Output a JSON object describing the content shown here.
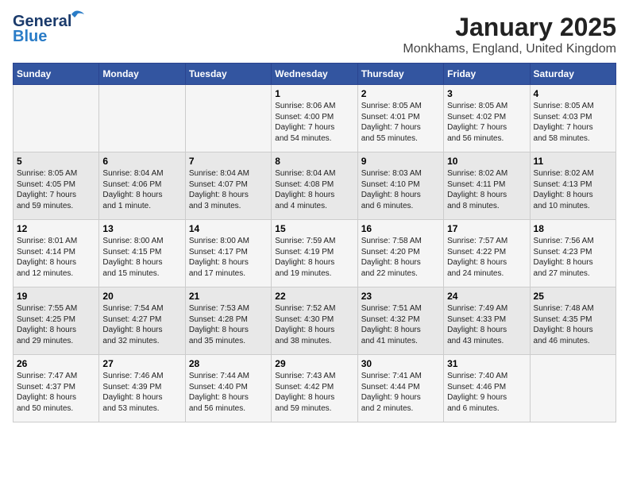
{
  "header": {
    "logo_general": "General",
    "logo_blue": "Blue",
    "month_title": "January 2025",
    "location": "Monkhams, England, United Kingdom"
  },
  "weekdays": [
    "Sunday",
    "Monday",
    "Tuesday",
    "Wednesday",
    "Thursday",
    "Friday",
    "Saturday"
  ],
  "weeks": [
    [
      {
        "day": "",
        "info": ""
      },
      {
        "day": "",
        "info": ""
      },
      {
        "day": "",
        "info": ""
      },
      {
        "day": "1",
        "info": "Sunrise: 8:06 AM\nSunset: 4:00 PM\nDaylight: 7 hours\nand 54 minutes."
      },
      {
        "day": "2",
        "info": "Sunrise: 8:05 AM\nSunset: 4:01 PM\nDaylight: 7 hours\nand 55 minutes."
      },
      {
        "day": "3",
        "info": "Sunrise: 8:05 AM\nSunset: 4:02 PM\nDaylight: 7 hours\nand 56 minutes."
      },
      {
        "day": "4",
        "info": "Sunrise: 8:05 AM\nSunset: 4:03 PM\nDaylight: 7 hours\nand 58 minutes."
      }
    ],
    [
      {
        "day": "5",
        "info": "Sunrise: 8:05 AM\nSunset: 4:05 PM\nDaylight: 7 hours\nand 59 minutes."
      },
      {
        "day": "6",
        "info": "Sunrise: 8:04 AM\nSunset: 4:06 PM\nDaylight: 8 hours\nand 1 minute."
      },
      {
        "day": "7",
        "info": "Sunrise: 8:04 AM\nSunset: 4:07 PM\nDaylight: 8 hours\nand 3 minutes."
      },
      {
        "day": "8",
        "info": "Sunrise: 8:04 AM\nSunset: 4:08 PM\nDaylight: 8 hours\nand 4 minutes."
      },
      {
        "day": "9",
        "info": "Sunrise: 8:03 AM\nSunset: 4:10 PM\nDaylight: 8 hours\nand 6 minutes."
      },
      {
        "day": "10",
        "info": "Sunrise: 8:02 AM\nSunset: 4:11 PM\nDaylight: 8 hours\nand 8 minutes."
      },
      {
        "day": "11",
        "info": "Sunrise: 8:02 AM\nSunset: 4:13 PM\nDaylight: 8 hours\nand 10 minutes."
      }
    ],
    [
      {
        "day": "12",
        "info": "Sunrise: 8:01 AM\nSunset: 4:14 PM\nDaylight: 8 hours\nand 12 minutes."
      },
      {
        "day": "13",
        "info": "Sunrise: 8:00 AM\nSunset: 4:15 PM\nDaylight: 8 hours\nand 15 minutes."
      },
      {
        "day": "14",
        "info": "Sunrise: 8:00 AM\nSunset: 4:17 PM\nDaylight: 8 hours\nand 17 minutes."
      },
      {
        "day": "15",
        "info": "Sunrise: 7:59 AM\nSunset: 4:19 PM\nDaylight: 8 hours\nand 19 minutes."
      },
      {
        "day": "16",
        "info": "Sunrise: 7:58 AM\nSunset: 4:20 PM\nDaylight: 8 hours\nand 22 minutes."
      },
      {
        "day": "17",
        "info": "Sunrise: 7:57 AM\nSunset: 4:22 PM\nDaylight: 8 hours\nand 24 minutes."
      },
      {
        "day": "18",
        "info": "Sunrise: 7:56 AM\nSunset: 4:23 PM\nDaylight: 8 hours\nand 27 minutes."
      }
    ],
    [
      {
        "day": "19",
        "info": "Sunrise: 7:55 AM\nSunset: 4:25 PM\nDaylight: 8 hours\nand 29 minutes."
      },
      {
        "day": "20",
        "info": "Sunrise: 7:54 AM\nSunset: 4:27 PM\nDaylight: 8 hours\nand 32 minutes."
      },
      {
        "day": "21",
        "info": "Sunrise: 7:53 AM\nSunset: 4:28 PM\nDaylight: 8 hours\nand 35 minutes."
      },
      {
        "day": "22",
        "info": "Sunrise: 7:52 AM\nSunset: 4:30 PM\nDaylight: 8 hours\nand 38 minutes."
      },
      {
        "day": "23",
        "info": "Sunrise: 7:51 AM\nSunset: 4:32 PM\nDaylight: 8 hours\nand 41 minutes."
      },
      {
        "day": "24",
        "info": "Sunrise: 7:49 AM\nSunset: 4:33 PM\nDaylight: 8 hours\nand 43 minutes."
      },
      {
        "day": "25",
        "info": "Sunrise: 7:48 AM\nSunset: 4:35 PM\nDaylight: 8 hours\nand 46 minutes."
      }
    ],
    [
      {
        "day": "26",
        "info": "Sunrise: 7:47 AM\nSunset: 4:37 PM\nDaylight: 8 hours\nand 50 minutes."
      },
      {
        "day": "27",
        "info": "Sunrise: 7:46 AM\nSunset: 4:39 PM\nDaylight: 8 hours\nand 53 minutes."
      },
      {
        "day": "28",
        "info": "Sunrise: 7:44 AM\nSunset: 4:40 PM\nDaylight: 8 hours\nand 56 minutes."
      },
      {
        "day": "29",
        "info": "Sunrise: 7:43 AM\nSunset: 4:42 PM\nDaylight: 8 hours\nand 59 minutes."
      },
      {
        "day": "30",
        "info": "Sunrise: 7:41 AM\nSunset: 4:44 PM\nDaylight: 9 hours\nand 2 minutes."
      },
      {
        "day": "31",
        "info": "Sunrise: 7:40 AM\nSunset: 4:46 PM\nDaylight: 9 hours\nand 6 minutes."
      },
      {
        "day": "",
        "info": ""
      }
    ]
  ]
}
